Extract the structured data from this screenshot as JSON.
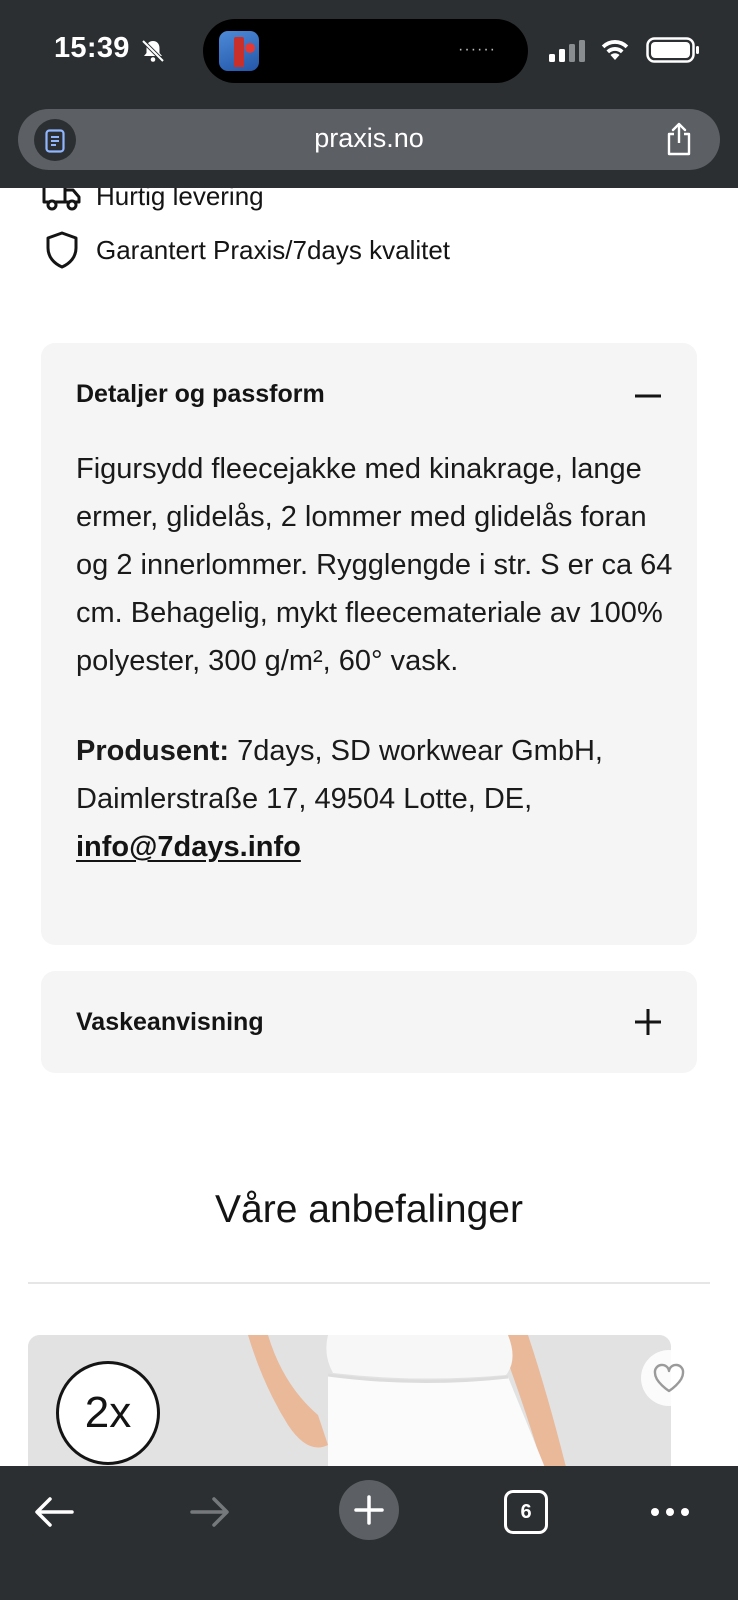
{
  "status_bar": {
    "time": "15:39",
    "icons": [
      "bell-slash-icon",
      "app-icon",
      "signal-icon",
      "wifi-icon",
      "battery-icon"
    ]
  },
  "browser": {
    "url": "praxis.no",
    "toolbar": {
      "tab_count": "6"
    }
  },
  "usps": [
    {
      "icon": "truck-icon",
      "label": "Hurtig levering"
    },
    {
      "icon": "shield-icon",
      "label": "Garantert Praxis/7days kvalitet"
    }
  ],
  "accordions": [
    {
      "title": "Detaljer og passform",
      "expanded": true,
      "description": "Figursydd fleecejakke med kinakrage, lange ermer, glidelås, 2 lommer med glidelås foran og 2 innerlommer. Rygglengde i str. S er ca 64 cm. Behagelig, mykt fleecemateriale av 100% polyester, 300 g/m², 60° vask.",
      "producer_label": "Produsent:",
      "producer_text": " 7days, SD workwear GmbH, Daimlerstraße 17, 49504 Lotte, DE, ",
      "producer_email": "info@7days.info"
    },
    {
      "title": "Vaskeanvisning",
      "expanded": false
    }
  ],
  "recommendations": {
    "title": "Våre anbefalinger",
    "products": [
      {
        "badge": "2x"
      }
    ]
  },
  "colors": {
    "chrome": "#2c2f32",
    "url_pill": "#5c5f63",
    "accordion_bg": "#f5f5f5"
  }
}
